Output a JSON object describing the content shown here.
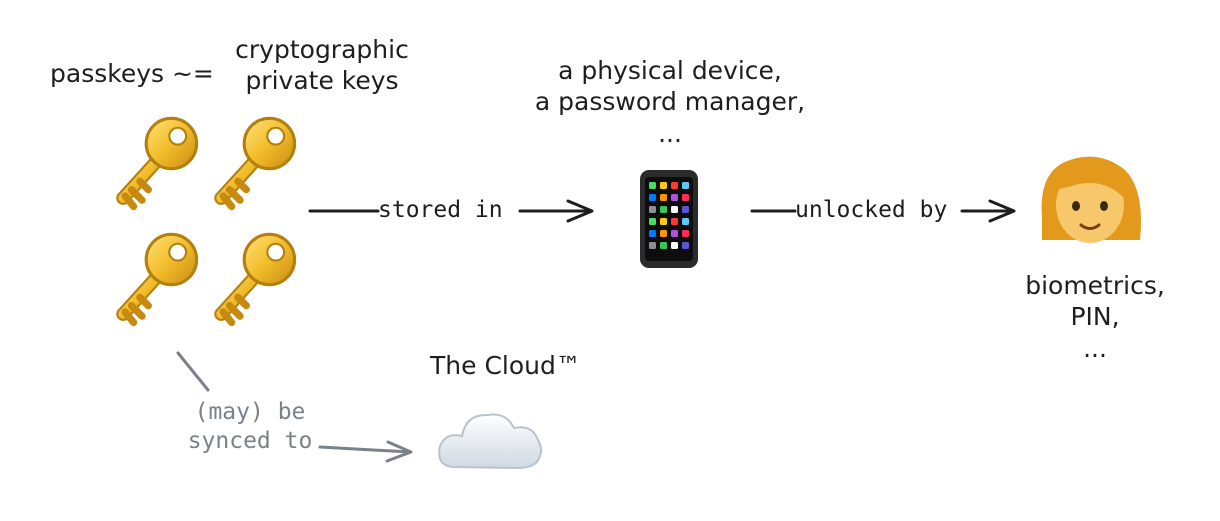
{
  "diagram": {
    "passkeys_label": "passkeys ~=",
    "private_keys_label": "cryptographic\nprivate keys",
    "device_label": "a physical device,\na password manager,\n...",
    "cloud_label": "The Cloud™",
    "biometrics_label": "biometrics,\nPIN,\n...",
    "edges": {
      "stored_in": "stored in",
      "unlocked_by": "unlocked by",
      "synced_to": "(may) be\nsynced to"
    },
    "icons": {
      "keys": "key-icon",
      "phone": "mobile-phone-icon",
      "person": "woman-icon",
      "cloud": "cloud-icon"
    },
    "colors": {
      "ink": "#1e1e1e",
      "muted": "#7a818a",
      "key_gold": "#e3ac1c",
      "skin": "#f7c76b",
      "hair": "#e39a1c"
    }
  }
}
